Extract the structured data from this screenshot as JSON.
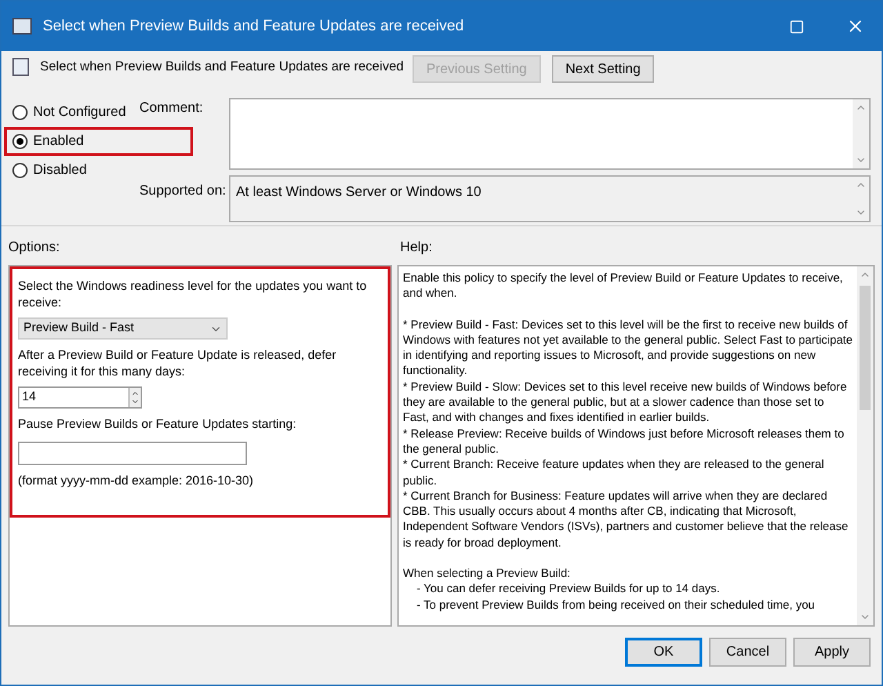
{
  "window": {
    "title": "Select when Preview Builds and Feature Updates are received"
  },
  "header": {
    "title": "Select when Preview Builds and Feature Updates are received",
    "buttons": [
      {
        "label": "Previous Setting",
        "disabled": true
      },
      {
        "label": "Next Setting",
        "disabled": false
      }
    ]
  },
  "state_options": [
    {
      "label": "Not Configured",
      "selected": false,
      "highlighted": false
    },
    {
      "label": "Enabled",
      "selected": true,
      "highlighted": true
    },
    {
      "label": "Disabled",
      "selected": false,
      "highlighted": false
    }
  ],
  "comment": {
    "label": "Comment:"
  },
  "supported_on": {
    "label": "Supported on:",
    "value": "At least Windows Server or Windows 10"
  },
  "options": {
    "label": "Options:",
    "highlighted": true,
    "readiness_label": "Select the Windows readiness level for the updates you want to receive:",
    "readiness_value": "Preview Build - Fast",
    "defer_label": "After a Preview Build or Feature Update is released, defer receiving it for this many days:",
    "defer_value": "14",
    "pause_label": "Pause Preview Builds or Feature Updates starting:",
    "format_hint": "(format yyyy-mm-dd example: 2016-10-30)"
  },
  "help": {
    "label": "Help:",
    "paragraphs": [
      {
        "kind": "text",
        "text": "Enable this policy to specify the level of Preview Build or Feature Updates to receive, and when."
      },
      {
        "kind": "gap"
      },
      {
        "kind": "text",
        "text": "* Preview Build - Fast: Devices set to this level will be the first to receive new builds of Windows with features not yet available to the general public. Select Fast to participate in identifying and reporting issues to Microsoft, and provide suggestions on new functionality."
      },
      {
        "kind": "text",
        "text": "* Preview Build - Slow: Devices set to this level receive new builds of Windows before they are available to the general public, but at a slower cadence than those set to Fast, and with changes and fixes identified in earlier builds."
      },
      {
        "kind": "text",
        "text": "* Release Preview: Receive builds of Windows just before Microsoft releases them to the general public."
      },
      {
        "kind": "text",
        "text": "* Current Branch: Receive feature updates when they are released to the general public."
      },
      {
        "kind": "text",
        "text": "* Current Branch for Business: Feature updates will arrive when they are declared CBB. This usually occurs about 4 months after CB, indicating that Microsoft, Independent Software Vendors (ISVs), partners and customer believe that the release is ready for broad deployment."
      },
      {
        "kind": "gap"
      },
      {
        "kind": "text",
        "text": "When selecting a Preview Build:"
      },
      {
        "kind": "sub",
        "text": "- You can defer receiving Preview Builds for up to 14 days."
      },
      {
        "kind": "sub",
        "text": "- To prevent Preview Builds from being received on their scheduled time, you"
      }
    ]
  },
  "footer": {
    "buttons": [
      {
        "label": "OK",
        "default": true
      },
      {
        "label": "Cancel",
        "default": false
      },
      {
        "label": "Apply",
        "default": false
      }
    ]
  }
}
